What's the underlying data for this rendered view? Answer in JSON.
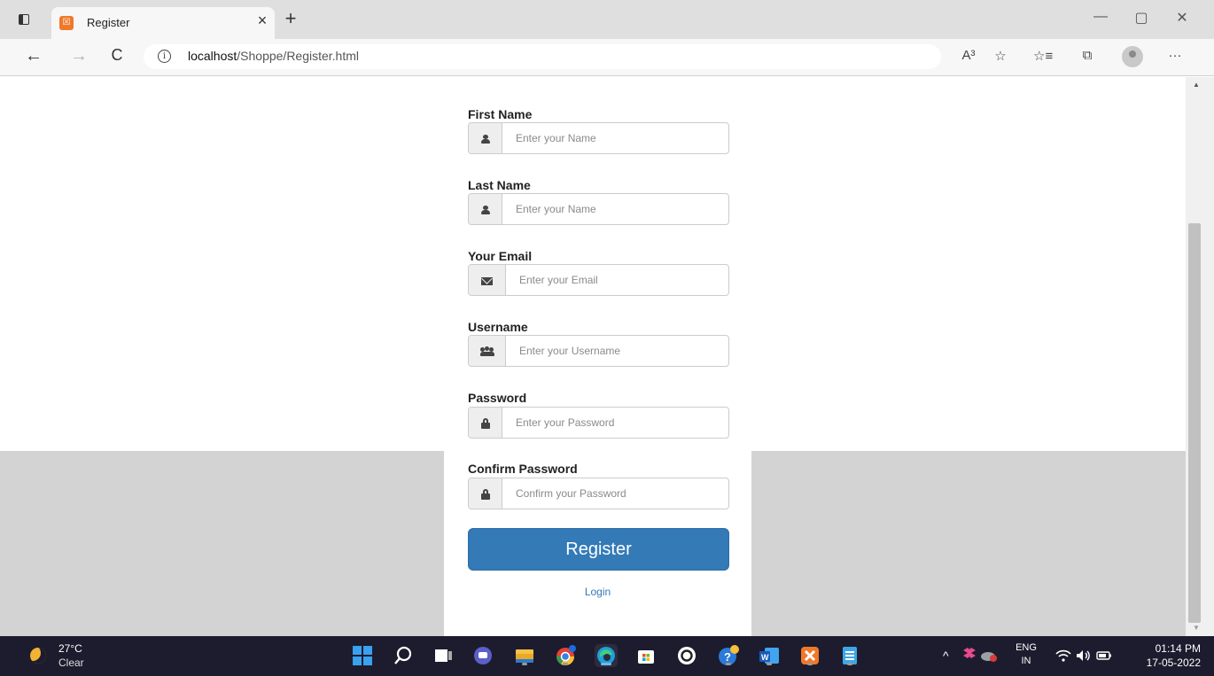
{
  "browser": {
    "tab": {
      "title": "Register",
      "close_symbol": "×"
    },
    "new_tab_symbol": "+",
    "window_controls": {
      "minimize": "—",
      "maximize": "▢",
      "close": "✕"
    },
    "nav": {
      "back": "←",
      "forward": "→",
      "refresh": "C"
    },
    "address": {
      "info_symbol": "i",
      "host": "localhost",
      "path": "/Shoppe/Register.html"
    },
    "toolbar": {
      "read_aloud": "A³",
      "add_favorite": "☆",
      "favorites": "☆≡",
      "collections": "⧉",
      "menu": "···"
    }
  },
  "form": {
    "fields": [
      {
        "label": "First Name",
        "placeholder": "Enter your Name",
        "icon": "user-icon"
      },
      {
        "label": "Last Name",
        "placeholder": "Enter your Name",
        "icon": "user-icon"
      },
      {
        "label": "Your Email",
        "placeholder": "Enter your Email",
        "icon": "envelope-icon"
      },
      {
        "label": "Username",
        "placeholder": "Enter your Username",
        "icon": "users-icon"
      },
      {
        "label": "Password",
        "placeholder": "Enter your Password",
        "icon": "lock-icon"
      },
      {
        "label": "Confirm Password",
        "placeholder": "Confirm your Password",
        "icon": "lock-icon"
      }
    ],
    "submit_label": "Register",
    "login_link": "Login",
    "accent_color": "#337ab7"
  },
  "taskbar": {
    "weather": {
      "temp": "27°C",
      "desc": "Clear"
    },
    "language": {
      "lang": "ENG",
      "region": "IN"
    },
    "clock": {
      "time": "01:14 PM",
      "date": "17-05-2022"
    },
    "tray_chevron": "^",
    "apps": [
      "start-icon",
      "search-icon",
      "task-view-icon",
      "chat-icon",
      "file-explorer-icon",
      "chrome-icon",
      "edge-icon",
      "store-icon",
      "chatgpt-icon",
      "help-icon",
      "word-icon",
      "xampp-icon",
      "notepad-icon"
    ]
  }
}
